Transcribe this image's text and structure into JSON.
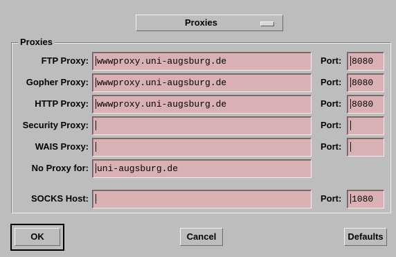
{
  "menu": {
    "label": "Proxies"
  },
  "group": {
    "title": "Proxies"
  },
  "rows": [
    {
      "label": "FTP Proxy:",
      "value": "wwwproxy.uni-augsburg.de",
      "port_label": "Port:",
      "port": "8080"
    },
    {
      "label": "Gopher Proxy:",
      "value": "wwwproxy.uni-augsburg.de",
      "port_label": "Port:",
      "port": "8080"
    },
    {
      "label": "HTTP Proxy:",
      "value": "wwwproxy.uni-augsburg.de",
      "port_label": "Port:",
      "port": "8080"
    },
    {
      "label": "Security Proxy:",
      "value": "",
      "port_label": "Port:",
      "port": ""
    },
    {
      "label": "WAIS Proxy:",
      "value": "",
      "port_label": "Port:",
      "port": ""
    },
    {
      "label": "No Proxy for:",
      "value": "uni-augsburg.de"
    }
  ],
  "socks": {
    "label": "SOCKS Host:",
    "value": "",
    "port_label": "Port:",
    "port": "1080"
  },
  "buttons": {
    "ok": "OK",
    "cancel": "Cancel",
    "defaults": "Defaults"
  },
  "colors": {
    "background": "#bdbdbd",
    "field": "#d9b1b4"
  }
}
